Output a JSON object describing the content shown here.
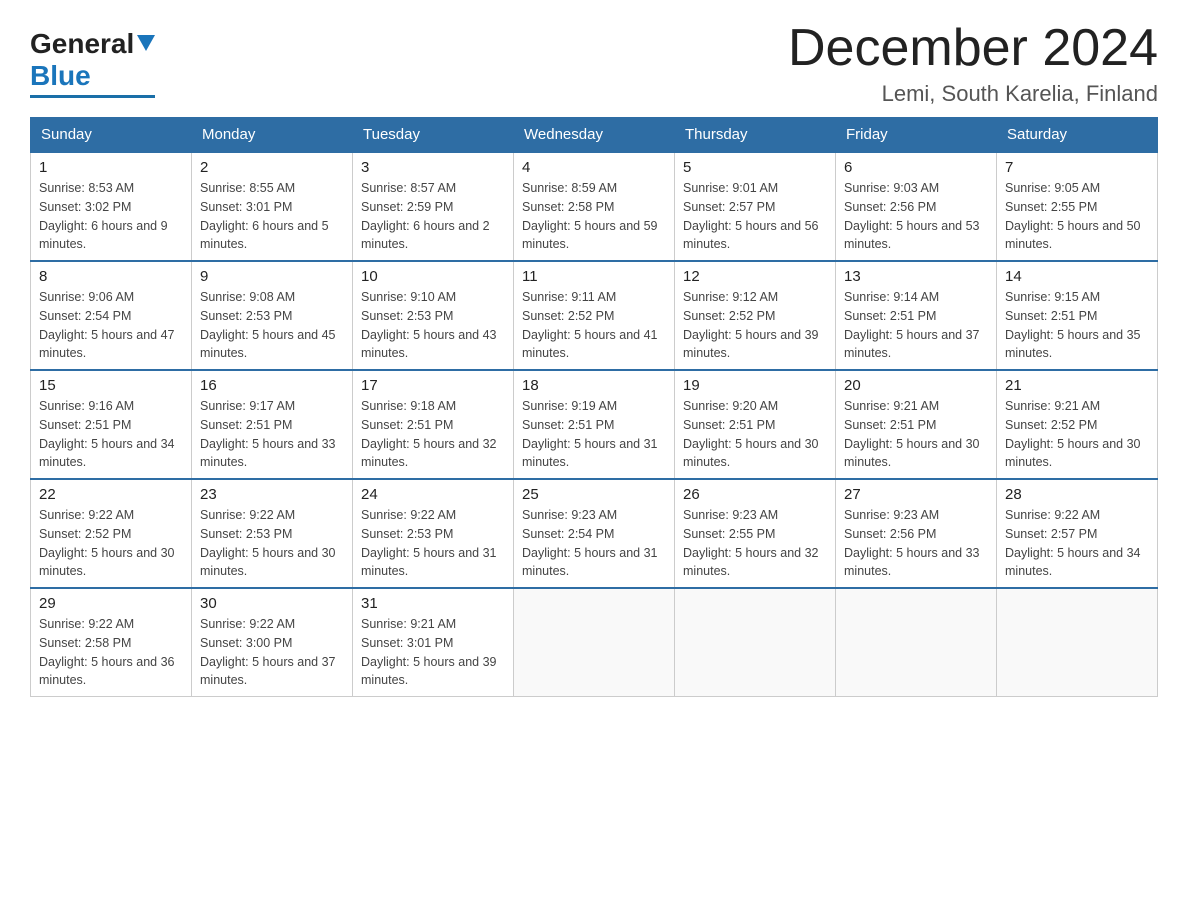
{
  "header": {
    "logo_general": "General",
    "logo_blue": "Blue",
    "title": "December 2024",
    "location": "Lemi, South Karelia, Finland"
  },
  "days_of_week": [
    "Sunday",
    "Monday",
    "Tuesday",
    "Wednesday",
    "Thursday",
    "Friday",
    "Saturday"
  ],
  "weeks": [
    [
      {
        "day": "1",
        "sunrise": "8:53 AM",
        "sunset": "3:02 PM",
        "daylight": "6 hours and 9 minutes."
      },
      {
        "day": "2",
        "sunrise": "8:55 AM",
        "sunset": "3:01 PM",
        "daylight": "6 hours and 5 minutes."
      },
      {
        "day": "3",
        "sunrise": "8:57 AM",
        "sunset": "2:59 PM",
        "daylight": "6 hours and 2 minutes."
      },
      {
        "day": "4",
        "sunrise": "8:59 AM",
        "sunset": "2:58 PM",
        "daylight": "5 hours and 59 minutes."
      },
      {
        "day": "5",
        "sunrise": "9:01 AM",
        "sunset": "2:57 PM",
        "daylight": "5 hours and 56 minutes."
      },
      {
        "day": "6",
        "sunrise": "9:03 AM",
        "sunset": "2:56 PM",
        "daylight": "5 hours and 53 minutes."
      },
      {
        "day": "7",
        "sunrise": "9:05 AM",
        "sunset": "2:55 PM",
        "daylight": "5 hours and 50 minutes."
      }
    ],
    [
      {
        "day": "8",
        "sunrise": "9:06 AM",
        "sunset": "2:54 PM",
        "daylight": "5 hours and 47 minutes."
      },
      {
        "day": "9",
        "sunrise": "9:08 AM",
        "sunset": "2:53 PM",
        "daylight": "5 hours and 45 minutes."
      },
      {
        "day": "10",
        "sunrise": "9:10 AM",
        "sunset": "2:53 PM",
        "daylight": "5 hours and 43 minutes."
      },
      {
        "day": "11",
        "sunrise": "9:11 AM",
        "sunset": "2:52 PM",
        "daylight": "5 hours and 41 minutes."
      },
      {
        "day": "12",
        "sunrise": "9:12 AM",
        "sunset": "2:52 PM",
        "daylight": "5 hours and 39 minutes."
      },
      {
        "day": "13",
        "sunrise": "9:14 AM",
        "sunset": "2:51 PM",
        "daylight": "5 hours and 37 minutes."
      },
      {
        "day": "14",
        "sunrise": "9:15 AM",
        "sunset": "2:51 PM",
        "daylight": "5 hours and 35 minutes."
      }
    ],
    [
      {
        "day": "15",
        "sunrise": "9:16 AM",
        "sunset": "2:51 PM",
        "daylight": "5 hours and 34 minutes."
      },
      {
        "day": "16",
        "sunrise": "9:17 AM",
        "sunset": "2:51 PM",
        "daylight": "5 hours and 33 minutes."
      },
      {
        "day": "17",
        "sunrise": "9:18 AM",
        "sunset": "2:51 PM",
        "daylight": "5 hours and 32 minutes."
      },
      {
        "day": "18",
        "sunrise": "9:19 AM",
        "sunset": "2:51 PM",
        "daylight": "5 hours and 31 minutes."
      },
      {
        "day": "19",
        "sunrise": "9:20 AM",
        "sunset": "2:51 PM",
        "daylight": "5 hours and 30 minutes."
      },
      {
        "day": "20",
        "sunrise": "9:21 AM",
        "sunset": "2:51 PM",
        "daylight": "5 hours and 30 minutes."
      },
      {
        "day": "21",
        "sunrise": "9:21 AM",
        "sunset": "2:52 PM",
        "daylight": "5 hours and 30 minutes."
      }
    ],
    [
      {
        "day": "22",
        "sunrise": "9:22 AM",
        "sunset": "2:52 PM",
        "daylight": "5 hours and 30 minutes."
      },
      {
        "day": "23",
        "sunrise": "9:22 AM",
        "sunset": "2:53 PM",
        "daylight": "5 hours and 30 minutes."
      },
      {
        "day": "24",
        "sunrise": "9:22 AM",
        "sunset": "2:53 PM",
        "daylight": "5 hours and 31 minutes."
      },
      {
        "day": "25",
        "sunrise": "9:23 AM",
        "sunset": "2:54 PM",
        "daylight": "5 hours and 31 minutes."
      },
      {
        "day": "26",
        "sunrise": "9:23 AM",
        "sunset": "2:55 PM",
        "daylight": "5 hours and 32 minutes."
      },
      {
        "day": "27",
        "sunrise": "9:23 AM",
        "sunset": "2:56 PM",
        "daylight": "5 hours and 33 minutes."
      },
      {
        "day": "28",
        "sunrise": "9:22 AM",
        "sunset": "2:57 PM",
        "daylight": "5 hours and 34 minutes."
      }
    ],
    [
      {
        "day": "29",
        "sunrise": "9:22 AM",
        "sunset": "2:58 PM",
        "daylight": "5 hours and 36 minutes."
      },
      {
        "day": "30",
        "sunrise": "9:22 AM",
        "sunset": "3:00 PM",
        "daylight": "5 hours and 37 minutes."
      },
      {
        "day": "31",
        "sunrise": "9:21 AM",
        "sunset": "3:01 PM",
        "daylight": "5 hours and 39 minutes."
      },
      null,
      null,
      null,
      null
    ]
  ]
}
